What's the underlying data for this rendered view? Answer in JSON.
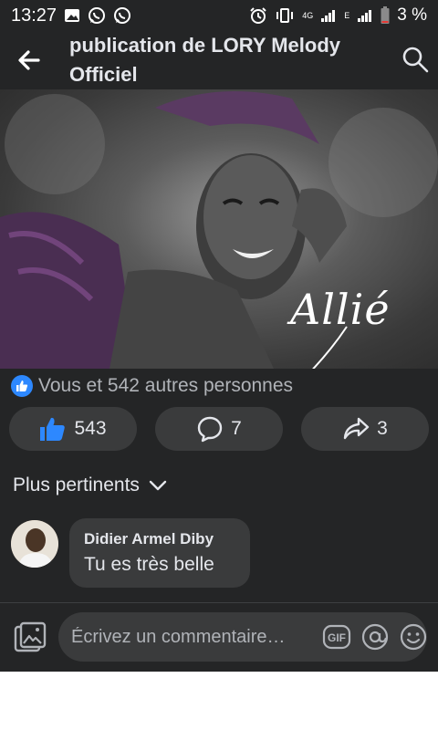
{
  "status_bar": {
    "time": "13:27",
    "network_4g": "4G",
    "network_e": "E",
    "battery": "3 %"
  },
  "header": {
    "title": "publication de LORY Melody Officiel"
  },
  "photo": {
    "signature_text": "Allié"
  },
  "reactions": {
    "summary": "Vous et 542 autres personnes"
  },
  "actions": {
    "likes": "543",
    "comments": "7",
    "shares": "3"
  },
  "sort": {
    "label": "Plus pertinents"
  },
  "comment": {
    "author": "Didier Armel Diby",
    "text": "Tu es très belle"
  },
  "composer": {
    "placeholder": "Écrivez un commentaire…"
  },
  "colors": {
    "background": "#242526",
    "surface": "#3a3b3c",
    "text": "#e4e6eb",
    "secondary_text": "#b0b3b8",
    "accent": "#2d88ff"
  }
}
